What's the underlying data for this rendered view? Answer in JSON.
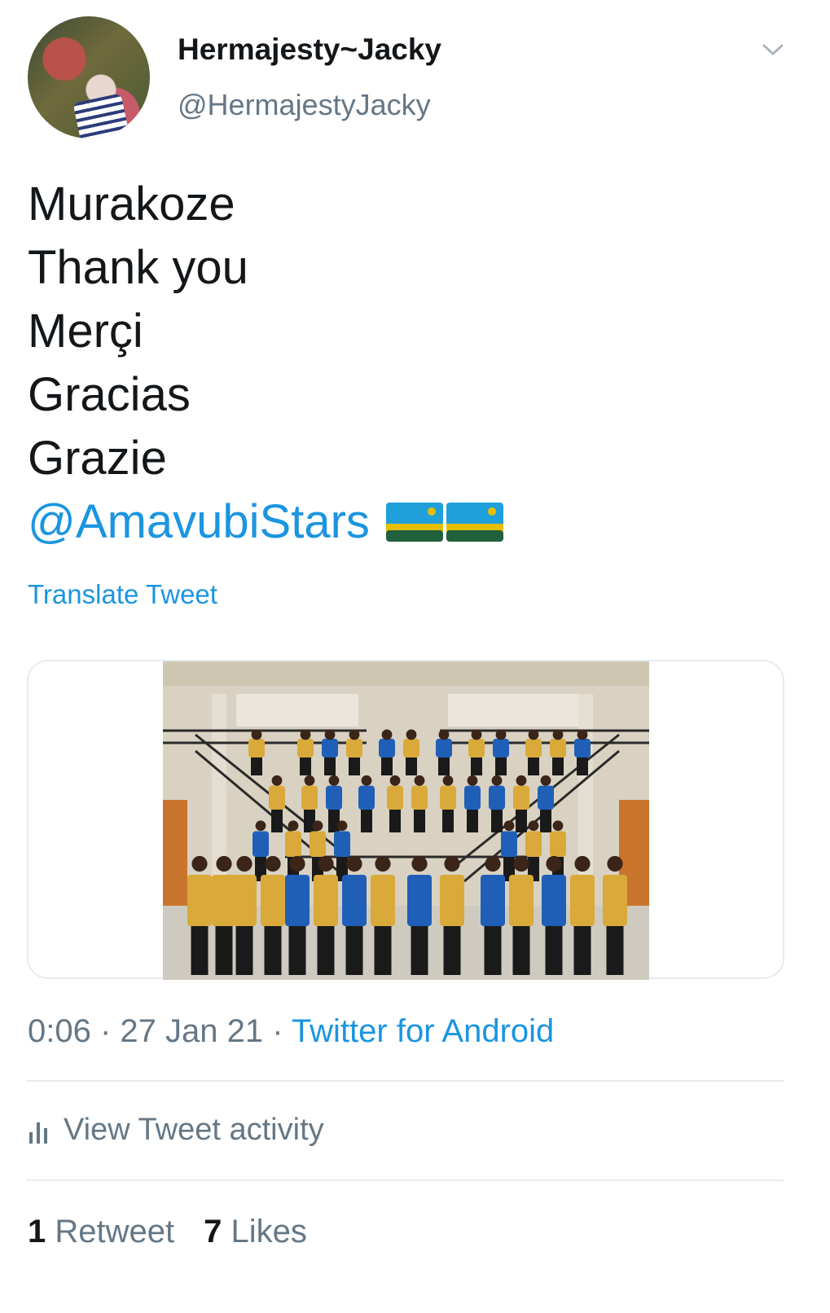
{
  "author": {
    "display_name": "Hermajesty~Jacky",
    "handle": "@HermajestyJacky",
    "avatar_icon": "profile-photo-avatar"
  },
  "menu_icon": "chevron-down-icon",
  "tweet": {
    "lines": [
      "Murakoze",
      "Thank you",
      "Merçi",
      "Gracias",
      "Grazie"
    ],
    "mention": "@AmavubiStars",
    "emoji": [
      "rwanda-flag",
      "rwanda-flag"
    ],
    "translate_label": "Translate Tweet"
  },
  "media": {
    "type": "photo",
    "subject": "team photo on staircase"
  },
  "meta": {
    "time": "0:06",
    "separator": " · ",
    "date": "27 Jan 21",
    "source": "Twitter for Android"
  },
  "activity": {
    "icon": "bar-chart-icon",
    "label": "View Tweet activity"
  },
  "stats": {
    "retweets_count": "1",
    "retweets_label": "Retweet",
    "likes_count": "7",
    "likes_label": "Likes"
  },
  "colors": {
    "link": "#1b95e0",
    "secondary_text": "#657786",
    "divider": "#e6ecf0",
    "flag_blue": "#20a0db",
    "flag_yellow": "#e5be01",
    "flag_green": "#20603d",
    "jersey_yellow": "#d9a93a",
    "jersey_blue": "#1f5fb8"
  }
}
